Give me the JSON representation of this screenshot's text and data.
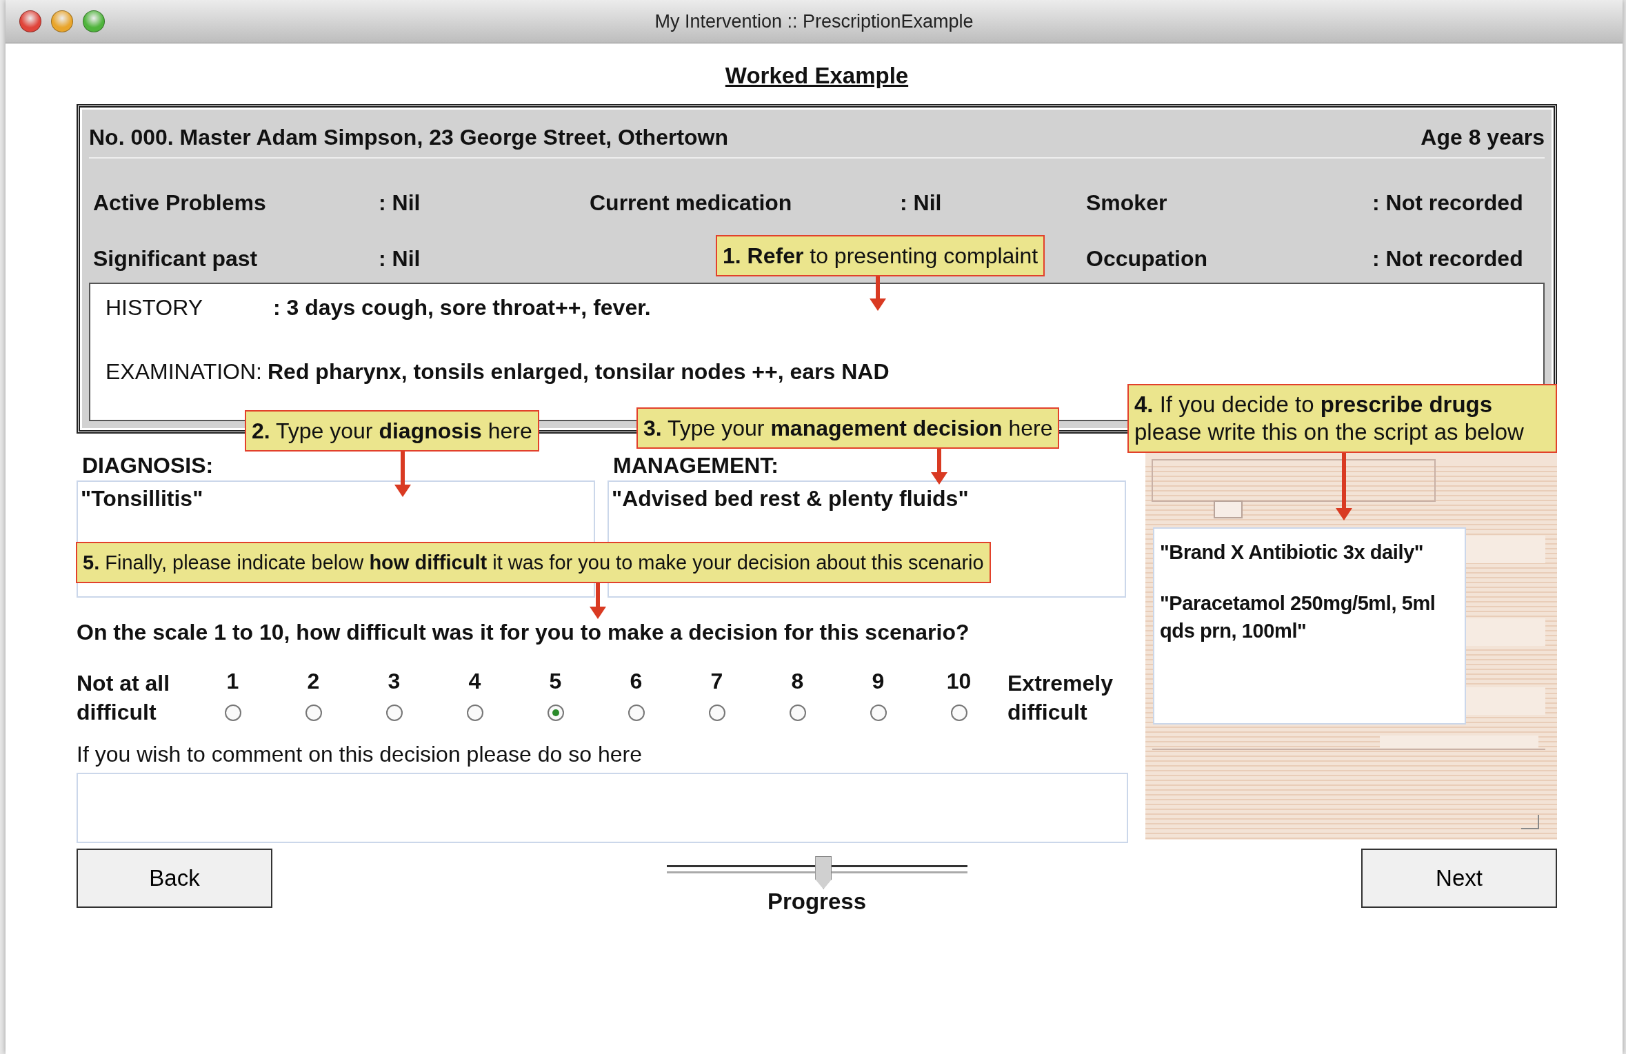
{
  "window": {
    "title": "My Intervention :: PrescriptionExample"
  },
  "heading": "Worked Example",
  "patient": {
    "name": "No. 000. Master Adam Simpson, 23 George Street, Othertown",
    "age": "Age 8 years",
    "columns": [
      {
        "fields": [
          {
            "label": "Active Problems",
            "value": ": Nil"
          },
          {
            "label": "Significant past",
            "value": ": Nil"
          }
        ]
      },
      {
        "fields": [
          {
            "label": "Current medication",
            "value": ": Nil"
          }
        ]
      },
      {
        "fields": [
          {
            "label": "Smoker",
            "value": ": Not recorded"
          },
          {
            "label": "Occupation",
            "value": ": Not recorded"
          }
        ]
      }
    ],
    "notes": [
      {
        "label": "HISTORY",
        "value": ": 3 days cough, sore throat++, fever."
      },
      {
        "label": "EXAMINATION:",
        "value": "Red pharynx, tonsils enlarged, tonsilar nodes ++, ears NAD"
      }
    ]
  },
  "callouts": [
    {
      "text": "**1. Refer** to presenting complaint"
    },
    {
      "text": "**2.** Type your **diagnosis** here"
    },
    {
      "text": "**3.** Type your **management decision** here"
    },
    {
      "text": "**4.** If you decide to **prescribe drugs** please write this on the script as below"
    },
    {
      "text": "**5.** Finally, please indicate below **how difficult** it was for you to make your decision about this scenario"
    }
  ],
  "diagnosis": {
    "label": "DIAGNOSIS:",
    "value": "\"Tonsillitis\""
  },
  "management": {
    "label": "MANAGEMENT:",
    "value": "\"Advised bed rest & plenty fluids\""
  },
  "prescription": {
    "lines": [
      "\"Brand X Antibiotic 3x daily\"",
      "\"Paracetamol 250mg/5ml, 5ml qds prn, 100ml\""
    ]
  },
  "difficulty": {
    "question": "On the scale 1 to 10, how difficult was it for you to make a decision for this scenario?",
    "low_label": "Not at all difficult",
    "high_label": "Extremely difficult",
    "options": [
      {
        "label": "1",
        "selected": false
      },
      {
        "label": "2",
        "selected": false
      },
      {
        "label": "3",
        "selected": false
      },
      {
        "label": "4",
        "selected": false
      },
      {
        "label": "5",
        "selected": true
      },
      {
        "label": "6",
        "selected": false
      },
      {
        "label": "7",
        "selected": false
      },
      {
        "label": "8",
        "selected": false
      },
      {
        "label": "9",
        "selected": false
      },
      {
        "label": "10",
        "selected": false
      }
    ]
  },
  "comment": {
    "label": "If you wish to comment on this decision please do so here"
  },
  "back_button": "Back",
  "next_button": "Next",
  "progress": {
    "label": "Progress",
    "level": 0.52
  }
}
